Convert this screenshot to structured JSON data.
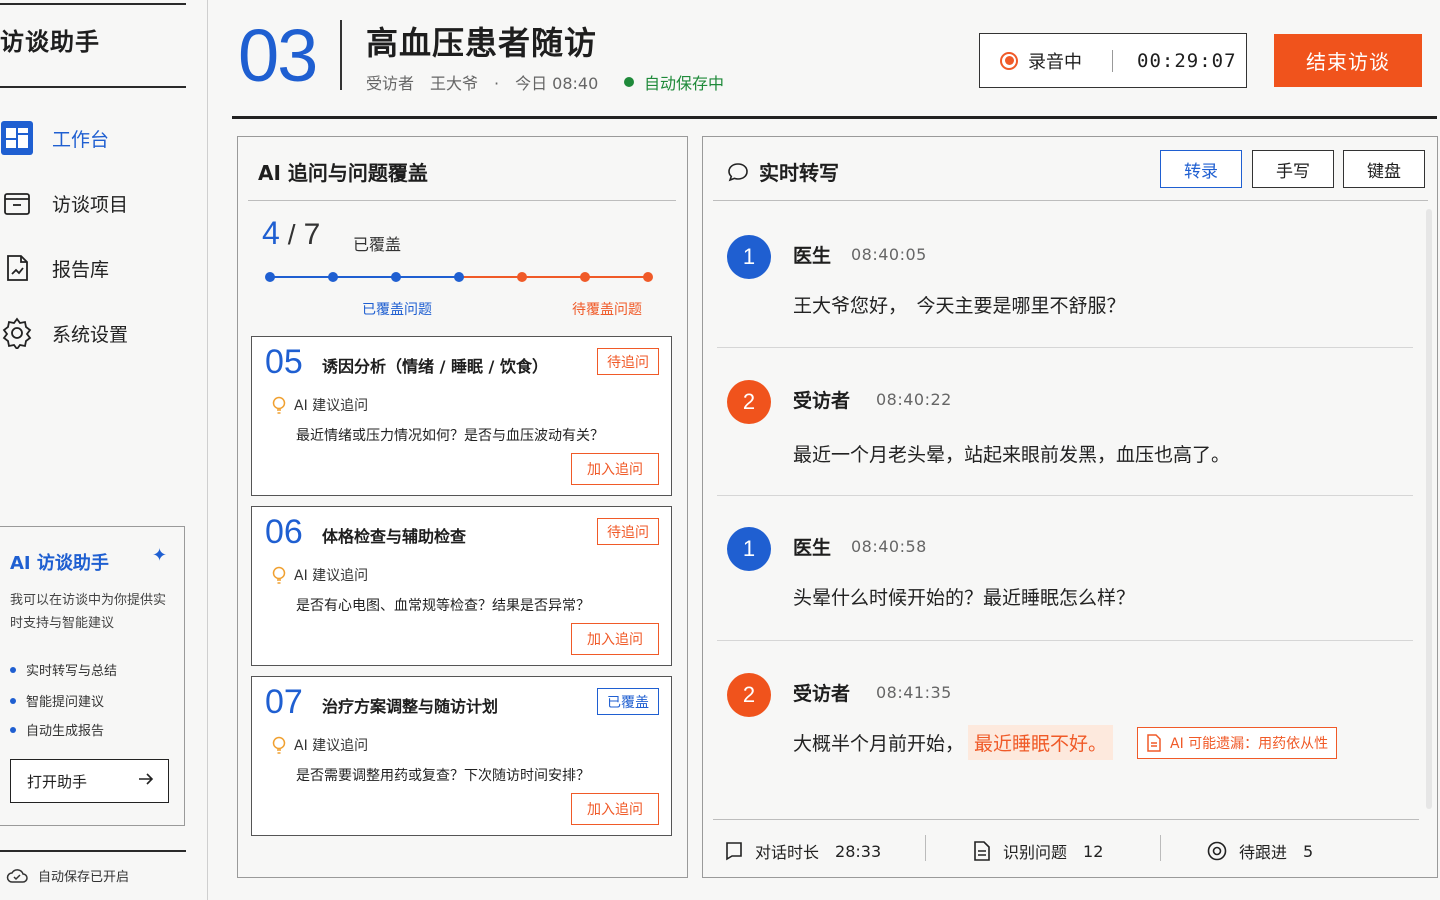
{
  "sidebar": {
    "app_title": "访谈助手",
    "nav": [
      {
        "label": "工作台",
        "icon": "dashboard-icon",
        "active": true
      },
      {
        "label": "访谈项目",
        "icon": "folder-icon",
        "active": false
      },
      {
        "label": "报告库",
        "icon": "report-icon",
        "active": false
      },
      {
        "label": "系统设置",
        "icon": "gear-icon",
        "active": false
      }
    ],
    "assistant": {
      "title": "AI 访谈助手",
      "desc": "我可以在访谈中为你提供实时支持与智能建议",
      "features": [
        "实时转写与总结",
        "智能提问建议",
        "自动生成报告"
      ],
      "open_label": "打开助手"
    },
    "autosave_label": "自动保存已开启"
  },
  "header": {
    "number": "03",
    "title": "高血压患者随访",
    "meta": "受访者　王大爷　·　今日 08:40",
    "autosave": "自动保存中",
    "recording_label": "录音中",
    "recording_time": "00:29:07",
    "end_label": "结束访谈"
  },
  "coverage": {
    "title": "AI 追问与问题覆盖",
    "covered": "4",
    "total": "7",
    "covered_label": "已覆盖",
    "progress": {
      "covered": 4,
      "total": 7
    },
    "legend_covered": "已覆盖问题",
    "legend_pending": "待覆盖问题",
    "colors": {
      "covered": "#1f5fd1",
      "pending": "#f05a28"
    }
  },
  "questions": [
    {
      "num": "05",
      "title": "诱因分析（情绪 / 睡眠 / 饮食）",
      "status": "待追问",
      "status_type": "pending",
      "ai_label": "AI 建议追问",
      "suggestion": "最近情绪或压力情况如何？是否与血压波动有关？",
      "add_label": "加入追问"
    },
    {
      "num": "06",
      "title": "体格检查与辅助检查",
      "status": "待追问",
      "status_type": "pending",
      "ai_label": "AI 建议追问",
      "suggestion": "是否有心电图、血常规等检查？结果是否异常？",
      "add_label": "加入追问"
    },
    {
      "num": "07",
      "title": "治疗方案调整与随访计划",
      "status": "已覆盖",
      "status_type": "covered",
      "ai_label": "AI 建议追问",
      "suggestion": "是否需要调整用药或复查？下次随访时间安排？",
      "add_label": "加入追问"
    }
  ],
  "transcript": {
    "title": "实时转写",
    "modes": [
      "转录",
      "手写",
      "键盘"
    ],
    "active_mode": 0,
    "messages": [
      {
        "avatar": "1",
        "speaker": "医生",
        "time": "08:40:05",
        "text": "王大爷您好，　今天主要是哪里不舒服？"
      },
      {
        "avatar": "2",
        "speaker": "受访者",
        "time": "08:40:22",
        "text": "最近一个月老头晕，站起来眼前发黑，血压也高了。"
      },
      {
        "avatar": "1",
        "speaker": "医生",
        "time": "08:40:58",
        "text": "头晕什么时候开始的？最近睡眠怎么样？"
      },
      {
        "avatar": "2",
        "speaker": "受访者",
        "time": "08:41:35",
        "text": "大概半个月前开始，",
        "highlight": "最近睡眠不好。",
        "ai_flag": "AI 可能遗漏：用药依从性"
      }
    ],
    "stats": [
      {
        "label": "对话时长",
        "value": "28:33",
        "icon": "chat-bubble-icon"
      },
      {
        "label": "识别问题",
        "value": "12",
        "icon": "document-icon"
      },
      {
        "label": "待跟进",
        "value": "5",
        "icon": "target-icon"
      }
    ]
  }
}
